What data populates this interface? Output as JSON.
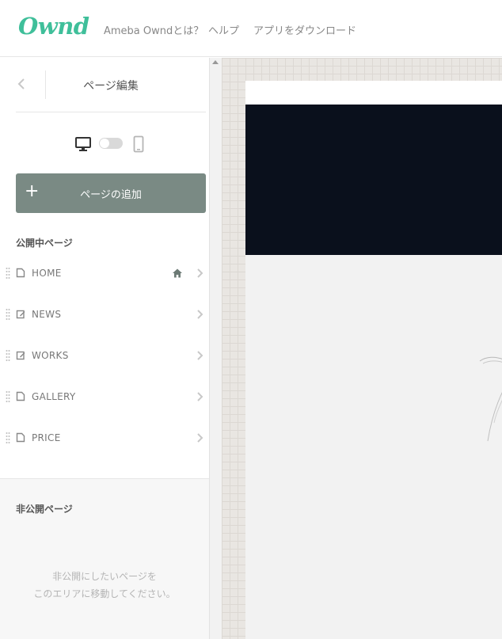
{
  "header": {
    "logo": "Ownd",
    "nav": [
      "Ameba Owndとは？",
      "ヘルプ",
      "アプリをダウンロード"
    ]
  },
  "sidebar": {
    "title": "ページ編集",
    "add_button": "ページの追加",
    "published_label": "公開中ページ",
    "pages": [
      {
        "label": "HOME",
        "icon": "page-icon",
        "is_home": true
      },
      {
        "label": "NEWS",
        "icon": "edit-icon",
        "is_home": false
      },
      {
        "label": "WORKS",
        "icon": "edit-icon",
        "is_home": false
      },
      {
        "label": "GALLERY",
        "icon": "page-icon",
        "is_home": false
      },
      {
        "label": "PRICE",
        "icon": "page-icon",
        "is_home": false
      }
    ],
    "private_label": "非公開ページ",
    "private_hint_1": "非公開にしたいページを",
    "private_hint_2": "このエリアに移動してください。"
  },
  "colors": {
    "brand": "#3fbf9a",
    "add_button": "#7a8a84",
    "hero": "#0a101c"
  }
}
